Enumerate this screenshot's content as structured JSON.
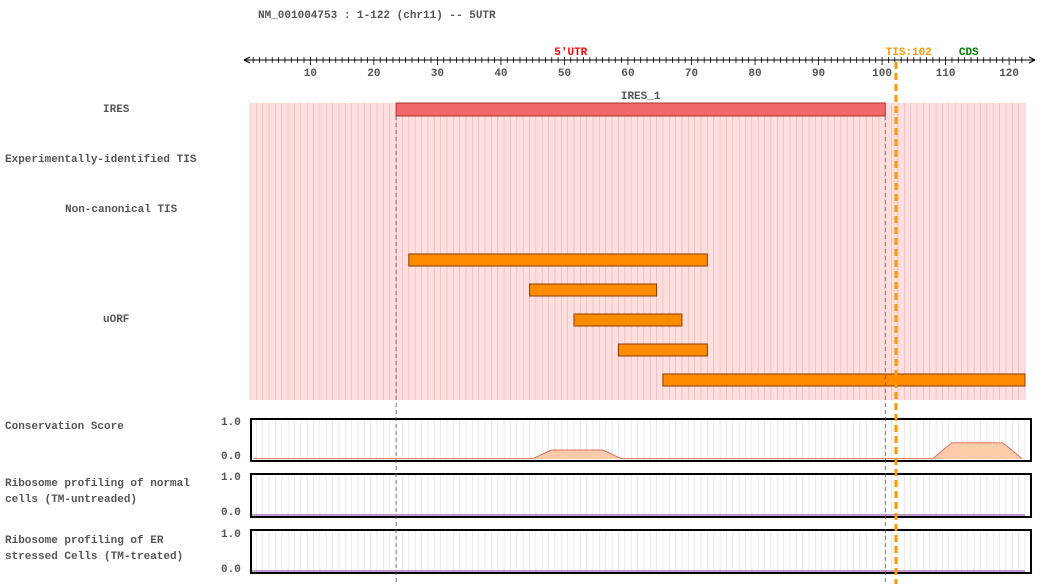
{
  "header": {
    "title": "NM_001004753 : 1-122 (chr11) -- 5UTR"
  },
  "ruler": {
    "utr_label": "5'UTR",
    "tis_label": "TIS:102",
    "cds_label": "CDS",
    "min": 1,
    "max": 122,
    "tick_labels": [
      10,
      20,
      30,
      40,
      50,
      60,
      70,
      80,
      90,
      100,
      110,
      120
    ],
    "tis_position": 102
  },
  "tracks": {
    "ires": {
      "label": "IRES",
      "features": [
        {
          "name": "IRES_1",
          "start": 24,
          "end": 101
        }
      ]
    },
    "exp_tis": {
      "label": "Experimentally-identified TIS"
    },
    "noncanonical_tis": {
      "label": "Non-canonical TIS"
    },
    "uorf": {
      "label": "uORF",
      "features": [
        {
          "start": 26,
          "end": 73
        },
        {
          "start": 45,
          "end": 65
        },
        {
          "start": 52,
          "end": 69
        },
        {
          "start": 59,
          "end": 73
        },
        {
          "start": 66,
          "end": 122
        }
      ]
    }
  },
  "plots": {
    "conservation": {
      "label": "Conservation Score",
      "y_max_label": "1.0",
      "y_min_label": "0.0",
      "ylim": [
        0,
        1
      ],
      "peaks": [
        {
          "start": 45,
          "end": 59,
          "height": 0.25
        },
        {
          "start": 108,
          "end": 122,
          "height": 0.45
        }
      ]
    },
    "ribo_normal": {
      "label": "Ribosome profiling of normal\ncells (TM-untreaded)",
      "y_max_label": "1.0",
      "y_min_label": "0.0",
      "ylim": [
        0,
        1
      ]
    },
    "ribo_er": {
      "label": "Ribosome profiling of ER\nstressed Cells (TM-treated)",
      "y_max_label": "1.0",
      "y_min_label": "0.0",
      "ylim": [
        0,
        1
      ]
    }
  },
  "colors": {
    "ires_fill": "#f06868",
    "ires_stroke": "#b03030",
    "uorf_fill": "#ff8c00",
    "uorf_stroke": "#8b3a00",
    "track_bg": "#ffdede",
    "tis": "#ff9900",
    "utr": "#ff0000",
    "cds": "#008000",
    "conservation_fill": "#ffccaa",
    "conservation_line": "#e07060",
    "ribo_line": "#8a3a9a"
  }
}
